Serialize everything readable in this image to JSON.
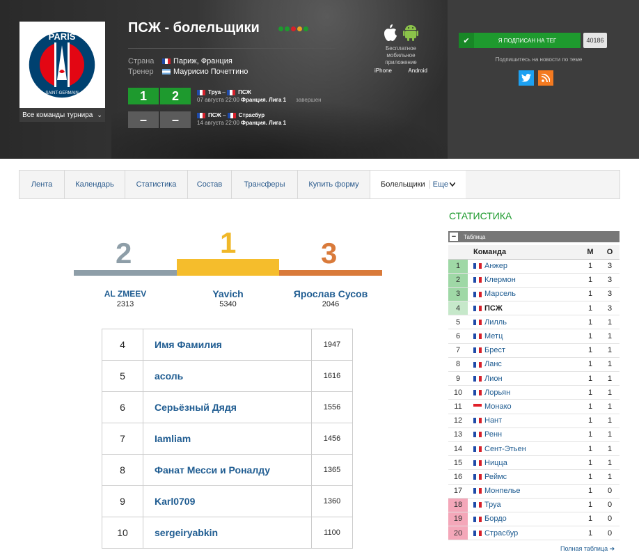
{
  "header": {
    "title": "ПСЖ - болельщики",
    "team_select": "Все команды турнира",
    "country_label": "Страна",
    "country_value": "Париж, Франция",
    "coach_label": "Тренер",
    "coach_value": "Маурисио Почеттино",
    "logo_text_top": "PARIS",
    "logo_text_bottom": "SAINT-GERMAIN",
    "matches": [
      {
        "score_home": "1",
        "score_away": "2",
        "home": "Труа",
        "away": "ПСЖ",
        "date": "07 августа 22:00",
        "league": "Франция. Лига 1",
        "status": "завершен"
      },
      {
        "score_home": "–",
        "score_away": "–",
        "home": "ПСЖ",
        "away": "Страсбур",
        "date": "14 августа 22:00",
        "league": "Франция. Лига 1",
        "status": ""
      }
    ],
    "apps": {
      "text": "Бесплатное мобильное приложение",
      "iphone": "iPhone",
      "android": "Android"
    },
    "subscribe": {
      "label": "Я ПОДПИСАН НА ТЕГ",
      "count": "40186",
      "note": "Подпишитесь на новости по теме"
    },
    "colors": {
      "green": "#1e9a2e",
      "dark": "#2f2f2f"
    }
  },
  "tabs": [
    "Лента",
    "Календарь",
    "Статистика",
    "Состав",
    "Трансферы",
    "Купить форму",
    "Болельщики"
  ],
  "tabs_more": "Еще",
  "podium": [
    {
      "place": "2",
      "name": "AL ZMEEV",
      "points": "2313"
    },
    {
      "place": "1",
      "name": "Yavich",
      "points": "5340"
    },
    {
      "place": "3",
      "name": "Ярослав Сусов",
      "points": "2046"
    }
  ],
  "ranking": [
    {
      "n": "4",
      "name": "Имя Фамилия",
      "points": "1947"
    },
    {
      "n": "5",
      "name": "асоль",
      "points": "1616"
    },
    {
      "n": "6",
      "name": "Серьёзный Дядя",
      "points": "1556"
    },
    {
      "n": "7",
      "name": "Iamliam",
      "points": "1456"
    },
    {
      "n": "8",
      "name": "Фанат Месси и Роналду",
      "points": "1365"
    },
    {
      "n": "9",
      "name": "Karl0709",
      "points": "1360"
    },
    {
      "n": "10",
      "name": "sergeiryabkin",
      "points": "1100"
    }
  ],
  "stats": {
    "title": "СТАТИСТИКА",
    "table_label": "Таблица",
    "col_team": "Команда",
    "col_m": "М",
    "col_o": "О",
    "full_link": "Полная таблица",
    "rows": [
      {
        "pos": "1",
        "team": "Анжер",
        "m": "1",
        "o": "3",
        "zone": "cl",
        "flag": "fr"
      },
      {
        "pos": "2",
        "team": "Клермон",
        "m": "1",
        "o": "3",
        "zone": "cl",
        "flag": "fr"
      },
      {
        "pos": "3",
        "team": "Марсель",
        "m": "1",
        "o": "3",
        "zone": "cl",
        "flag": "fr"
      },
      {
        "pos": "4",
        "team": "ПСЖ",
        "m": "1",
        "o": "3",
        "zone": "el",
        "flag": "fr",
        "bold": true
      },
      {
        "pos": "5",
        "team": "Лилль",
        "m": "1",
        "o": "1",
        "zone": "",
        "flag": "fr"
      },
      {
        "pos": "6",
        "team": "Метц",
        "m": "1",
        "o": "1",
        "zone": "",
        "flag": "fr"
      },
      {
        "pos": "7",
        "team": "Брест",
        "m": "1",
        "o": "1",
        "zone": "",
        "flag": "fr"
      },
      {
        "pos": "8",
        "team": "Ланс",
        "m": "1",
        "o": "1",
        "zone": "",
        "flag": "fr"
      },
      {
        "pos": "9",
        "team": "Лион",
        "m": "1",
        "o": "1",
        "zone": "",
        "flag": "fr"
      },
      {
        "pos": "10",
        "team": "Лорьян",
        "m": "1",
        "o": "1",
        "zone": "",
        "flag": "fr"
      },
      {
        "pos": "11",
        "team": "Монако",
        "m": "1",
        "o": "1",
        "zone": "",
        "flag": "mc"
      },
      {
        "pos": "12",
        "team": "Нант",
        "m": "1",
        "o": "1",
        "zone": "",
        "flag": "fr"
      },
      {
        "pos": "13",
        "team": "Ренн",
        "m": "1",
        "o": "1",
        "zone": "",
        "flag": "fr"
      },
      {
        "pos": "14",
        "team": "Сент-Этьен",
        "m": "1",
        "o": "1",
        "zone": "",
        "flag": "fr"
      },
      {
        "pos": "15",
        "team": "Ницца",
        "m": "1",
        "o": "1",
        "zone": "",
        "flag": "fr"
      },
      {
        "pos": "16",
        "team": "Реймс",
        "m": "1",
        "o": "1",
        "zone": "",
        "flag": "fr"
      },
      {
        "pos": "17",
        "team": "Монпелье",
        "m": "1",
        "o": "0",
        "zone": "",
        "flag": "fr"
      },
      {
        "pos": "18",
        "team": "Труа",
        "m": "1",
        "o": "0",
        "zone": "rel",
        "flag": "fr"
      },
      {
        "pos": "19",
        "team": "Бордо",
        "m": "1",
        "o": "0",
        "zone": "rel",
        "flag": "fr"
      },
      {
        "pos": "20",
        "team": "Страсбур",
        "m": "1",
        "o": "0",
        "zone": "rel",
        "flag": "fr"
      }
    ]
  }
}
